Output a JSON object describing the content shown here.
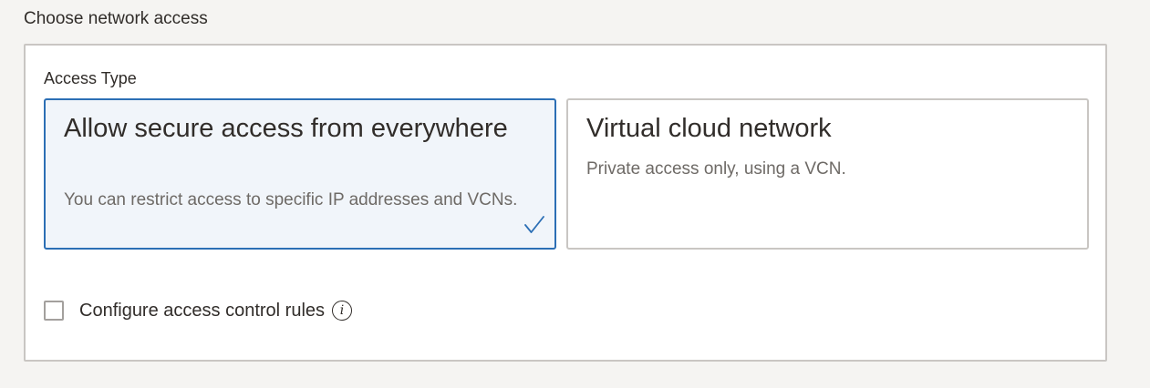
{
  "section": {
    "title": "Choose network access"
  },
  "access_type": {
    "label": "Access Type",
    "options": [
      {
        "title": "Allow secure access from everywhere",
        "description": "You can restrict access to specific IP addresses and VCNs.",
        "selected": true
      },
      {
        "title": "Virtual cloud network",
        "description": "Private access only, using a VCN.",
        "selected": false
      }
    ]
  },
  "access_control": {
    "checkbox_label": "Configure access control rules",
    "checked": false,
    "info_icon": "info-icon",
    "info_glyph": "i"
  },
  "colors": {
    "accent": "#2c6fb5",
    "selected_background": "#f1f5fa",
    "border": "#c9c6c3",
    "text": "#312d2a",
    "muted_text": "#6e6a66"
  }
}
